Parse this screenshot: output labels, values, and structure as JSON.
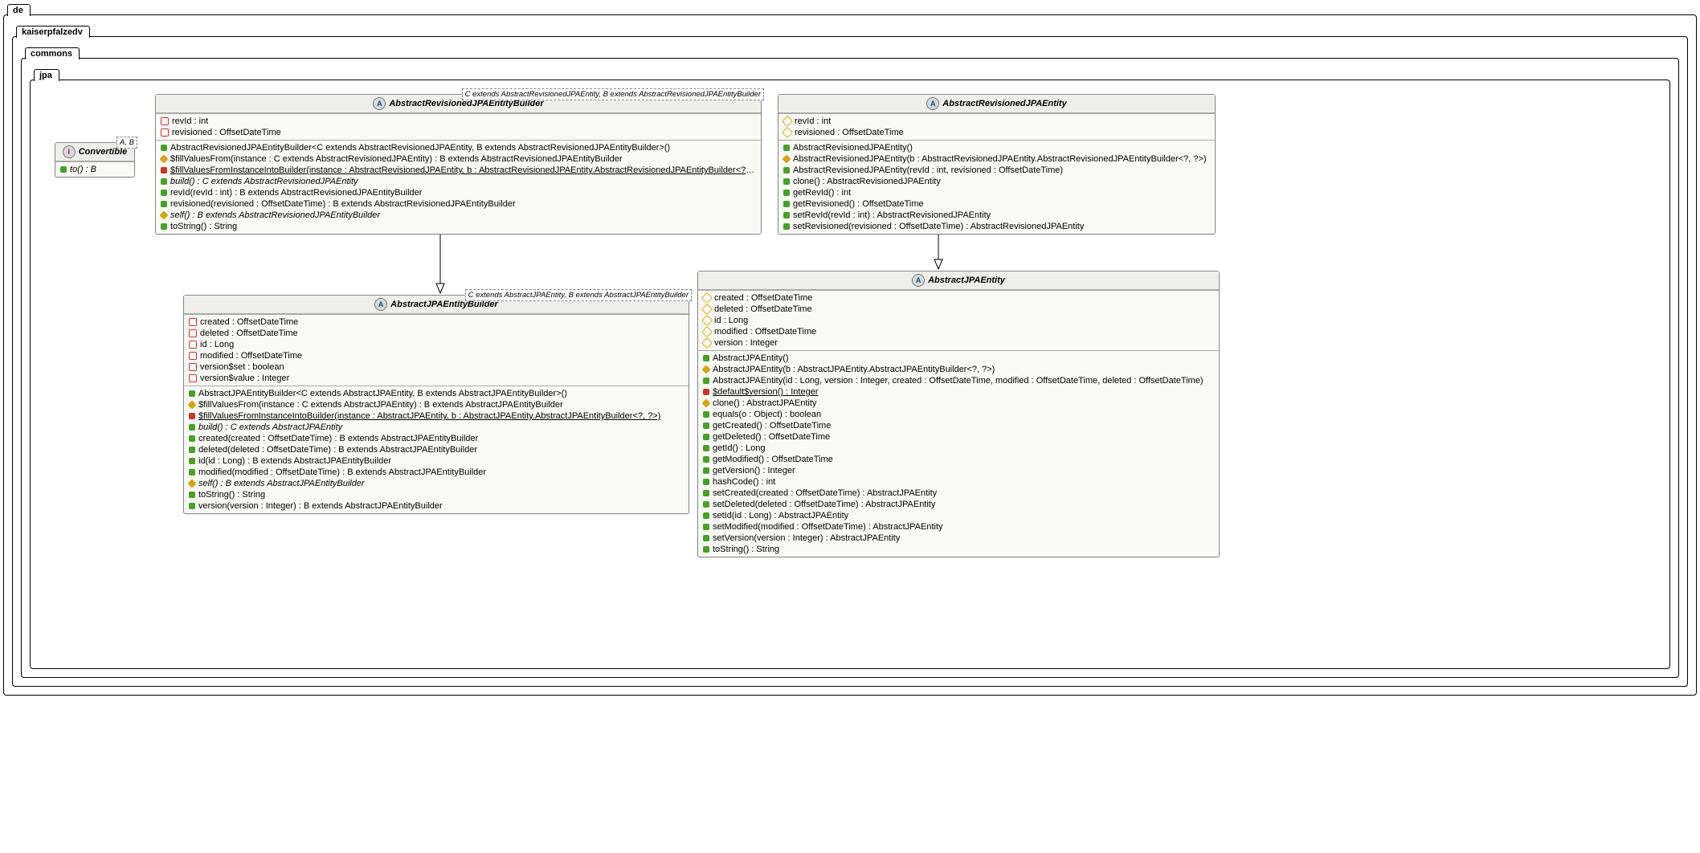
{
  "packages": {
    "p0": "de",
    "p1": "kaiserpfalzedv",
    "p2": "commons",
    "p3": "jpa"
  },
  "convertible": {
    "name": "Convertible",
    "tpl": "A, B",
    "methods": [
      {
        "vis": "public",
        "text": "to() : B",
        "italic": true
      }
    ]
  },
  "arjpeb": {
    "name": "AbstractRevisionedJPAEntityBuilder",
    "tpl": "C extends AbstractRevisionedJPAEntity, B extends AbstractRevisionedJPAEntityBuilder",
    "fields": [
      {
        "vis": "private",
        "text": "revId : int"
      },
      {
        "vis": "private",
        "text": "revisioned : OffsetDateTime"
      }
    ],
    "methods": [
      {
        "vis": "public",
        "text": "AbstractRevisionedJPAEntityBuilder<C extends AbstractRevisionedJPAEntity, B extends AbstractRevisionedJPAEntityBuilder>()"
      },
      {
        "vis": "protected",
        "text": "$fillValuesFrom(instance : C extends AbstractRevisionedJPAEntity) : B extends AbstractRevisionedJPAEntityBuilder"
      },
      {
        "vis": "private-solid",
        "text": "$fillValuesFromInstanceIntoBuilder(instance : AbstractRevisionedJPAEntity, b : AbstractRevisionedJPAEntity.AbstractRevisionedJPAEntityBuilder<?, ?>)",
        "underline": true
      },
      {
        "vis": "public",
        "text": "build() : C extends AbstractRevisionedJPAEntity",
        "italic": true
      },
      {
        "vis": "public",
        "text": "revId(revId : int) : B extends AbstractRevisionedJPAEntityBuilder"
      },
      {
        "vis": "public",
        "text": "revisioned(revisioned : OffsetDateTime) : B extends AbstractRevisionedJPAEntityBuilder"
      },
      {
        "vis": "protected",
        "text": "self() : B extends AbstractRevisionedJPAEntityBuilder",
        "italic": true
      },
      {
        "vis": "public",
        "text": "toString() : String"
      }
    ]
  },
  "arjpe": {
    "name": "AbstractRevisionedJPAEntity",
    "fields": [
      {
        "vis": "protected-open",
        "text": "revId : int"
      },
      {
        "vis": "protected-open",
        "text": "revisioned : OffsetDateTime"
      }
    ],
    "methods": [
      {
        "vis": "public",
        "text": "AbstractRevisionedJPAEntity()"
      },
      {
        "vis": "protected",
        "text": "AbstractRevisionedJPAEntity(b : AbstractRevisionedJPAEntity.AbstractRevisionedJPAEntityBuilder<?, ?>)"
      },
      {
        "vis": "public",
        "text": "AbstractRevisionedJPAEntity(revId : int, revisioned : OffsetDateTime)"
      },
      {
        "vis": "public",
        "text": "clone() : AbstractRevisionedJPAEntity"
      },
      {
        "vis": "public",
        "text": "getRevId() : int"
      },
      {
        "vis": "public",
        "text": "getRevisioned() : OffsetDateTime"
      },
      {
        "vis": "public",
        "text": "setRevId(revId : int) : AbstractRevisionedJPAEntity"
      },
      {
        "vis": "public",
        "text": "setRevisioned(revisioned : OffsetDateTime) : AbstractRevisionedJPAEntity"
      }
    ]
  },
  "ajpeb": {
    "name": "AbstractJPAEntityBuilder",
    "tpl": "C extends AbstractJPAEntity, B extends AbstractJPAEntityBuilder",
    "fields": [
      {
        "vis": "private",
        "text": "created : OffsetDateTime"
      },
      {
        "vis": "private",
        "text": "deleted : OffsetDateTime"
      },
      {
        "vis": "private",
        "text": "id : Long"
      },
      {
        "vis": "private",
        "text": "modified : OffsetDateTime"
      },
      {
        "vis": "private",
        "text": "version$set : boolean"
      },
      {
        "vis": "private",
        "text": "version$value : Integer"
      }
    ],
    "methods": [
      {
        "vis": "public",
        "text": "AbstractJPAEntityBuilder<C extends AbstractJPAEntity, B extends AbstractJPAEntityBuilder>()"
      },
      {
        "vis": "protected",
        "text": "$fillValuesFrom(instance : C extends AbstractJPAEntity) : B extends AbstractJPAEntityBuilder"
      },
      {
        "vis": "private-solid",
        "text": "$fillValuesFromInstanceIntoBuilder(instance : AbstractJPAEntity, b : AbstractJPAEntity.AbstractJPAEntityBuilder<?, ?>)",
        "underline": true
      },
      {
        "vis": "public",
        "text": "build() : C extends AbstractJPAEntity",
        "italic": true
      },
      {
        "vis": "public",
        "text": "created(created : OffsetDateTime) : B extends AbstractJPAEntityBuilder"
      },
      {
        "vis": "public",
        "text": "deleted(deleted : OffsetDateTime) : B extends AbstractJPAEntityBuilder"
      },
      {
        "vis": "public",
        "text": "id(id : Long) : B extends AbstractJPAEntityBuilder"
      },
      {
        "vis": "public",
        "text": "modified(modified : OffsetDateTime) : B extends AbstractJPAEntityBuilder"
      },
      {
        "vis": "protected",
        "text": "self() : B extends AbstractJPAEntityBuilder",
        "italic": true
      },
      {
        "vis": "public",
        "text": "toString() : String"
      },
      {
        "vis": "public",
        "text": "version(version : Integer) : B extends AbstractJPAEntityBuilder"
      }
    ]
  },
  "ajpe": {
    "name": "AbstractJPAEntity",
    "fields": [
      {
        "vis": "protected-open",
        "text": "created : OffsetDateTime"
      },
      {
        "vis": "protected-open",
        "text": "deleted : OffsetDateTime"
      },
      {
        "vis": "protected-open",
        "text": "id : Long"
      },
      {
        "vis": "protected-open",
        "text": "modified : OffsetDateTime"
      },
      {
        "vis": "protected-open",
        "text": "version : Integer"
      }
    ],
    "methods": [
      {
        "vis": "public",
        "text": "AbstractJPAEntity()"
      },
      {
        "vis": "protected",
        "text": "AbstractJPAEntity(b : AbstractJPAEntity.AbstractJPAEntityBuilder<?, ?>)"
      },
      {
        "vis": "public",
        "text": "AbstractJPAEntity(id : Long, version : Integer, created : OffsetDateTime, modified : OffsetDateTime, deleted : OffsetDateTime)"
      },
      {
        "vis": "private-solid",
        "text": "$default$version() : Integer",
        "underline": true
      },
      {
        "vis": "protected",
        "text": "clone() : AbstractJPAEntity"
      },
      {
        "vis": "public",
        "text": "equals(o : Object) : boolean"
      },
      {
        "vis": "public",
        "text": "getCreated() : OffsetDateTime"
      },
      {
        "vis": "public",
        "text": "getDeleted() : OffsetDateTime"
      },
      {
        "vis": "public",
        "text": "getId() : Long"
      },
      {
        "vis": "public",
        "text": "getModified() : OffsetDateTime"
      },
      {
        "vis": "public",
        "text": "getVersion() : Integer"
      },
      {
        "vis": "public",
        "text": "hashCode() : int"
      },
      {
        "vis": "public",
        "text": "setCreated(created : OffsetDateTime) : AbstractJPAEntity"
      },
      {
        "vis": "public",
        "text": "setDeleted(deleted : OffsetDateTime) : AbstractJPAEntity"
      },
      {
        "vis": "public",
        "text": "setId(id : Long) : AbstractJPAEntity"
      },
      {
        "vis": "public",
        "text": "setModified(modified : OffsetDateTime) : AbstractJPAEntity"
      },
      {
        "vis": "public",
        "text": "setVersion(version : Integer) : AbstractJPAEntity"
      },
      {
        "vis": "public",
        "text": "toString() : String"
      }
    ]
  }
}
